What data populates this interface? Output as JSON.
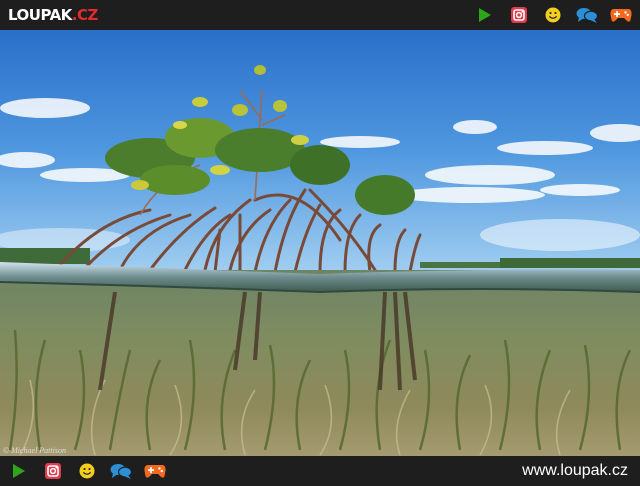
{
  "header": {
    "logo_brand": "LOUPAK",
    "logo_tld": ".CZ",
    "icons": [
      "play-icon",
      "instagram-icon",
      "smiley-icon",
      "chat-icon",
      "gamepad-icon"
    ]
  },
  "photo": {
    "subject": "mangrove split-level",
    "credit": "© Michael Pattison"
  },
  "footer": {
    "site": "www.loupak.cz",
    "icons": [
      "play-icon",
      "instagram-icon",
      "smiley-icon",
      "chat-icon",
      "gamepad-icon"
    ]
  },
  "colors": {
    "bar": "#1e1e1e",
    "play": "#2fa51b",
    "instagram": "#e33b4e",
    "smiley": "#f5cf1d",
    "chat": "#2a8fd6",
    "gamepad": "#f36a1f",
    "tld": "#e32c2c"
  }
}
